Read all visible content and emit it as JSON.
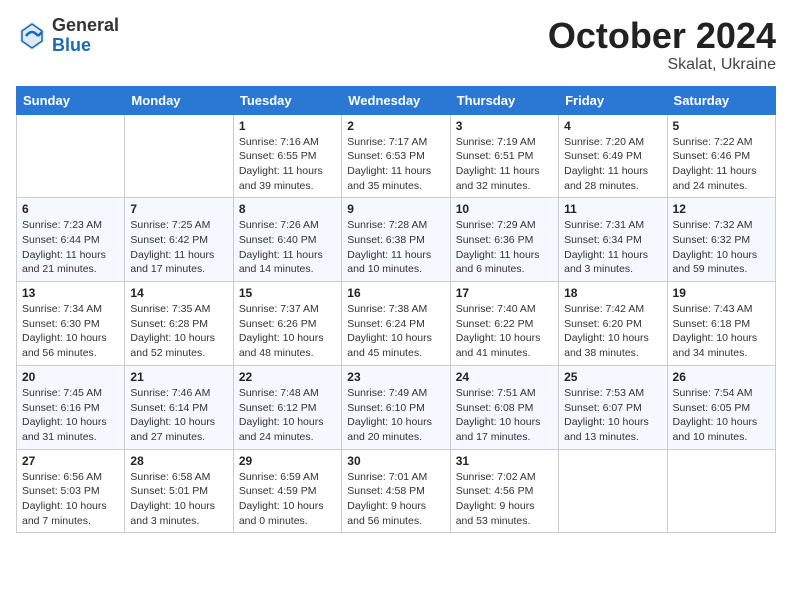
{
  "header": {
    "logo_general": "General",
    "logo_blue": "Blue",
    "month_title": "October 2024",
    "location": "Skalat, Ukraine"
  },
  "days_of_week": [
    "Sunday",
    "Monday",
    "Tuesday",
    "Wednesday",
    "Thursday",
    "Friday",
    "Saturday"
  ],
  "weeks": [
    [
      {
        "day": "",
        "sunrise": "",
        "sunset": "",
        "daylight": ""
      },
      {
        "day": "",
        "sunrise": "",
        "sunset": "",
        "daylight": ""
      },
      {
        "day": "1",
        "sunrise": "Sunrise: 7:16 AM",
        "sunset": "Sunset: 6:55 PM",
        "daylight": "Daylight: 11 hours and 39 minutes."
      },
      {
        "day": "2",
        "sunrise": "Sunrise: 7:17 AM",
        "sunset": "Sunset: 6:53 PM",
        "daylight": "Daylight: 11 hours and 35 minutes."
      },
      {
        "day": "3",
        "sunrise": "Sunrise: 7:19 AM",
        "sunset": "Sunset: 6:51 PM",
        "daylight": "Daylight: 11 hours and 32 minutes."
      },
      {
        "day": "4",
        "sunrise": "Sunrise: 7:20 AM",
        "sunset": "Sunset: 6:49 PM",
        "daylight": "Daylight: 11 hours and 28 minutes."
      },
      {
        "day": "5",
        "sunrise": "Sunrise: 7:22 AM",
        "sunset": "Sunset: 6:46 PM",
        "daylight": "Daylight: 11 hours and 24 minutes."
      }
    ],
    [
      {
        "day": "6",
        "sunrise": "Sunrise: 7:23 AM",
        "sunset": "Sunset: 6:44 PM",
        "daylight": "Daylight: 11 hours and 21 minutes."
      },
      {
        "day": "7",
        "sunrise": "Sunrise: 7:25 AM",
        "sunset": "Sunset: 6:42 PM",
        "daylight": "Daylight: 11 hours and 17 minutes."
      },
      {
        "day": "8",
        "sunrise": "Sunrise: 7:26 AM",
        "sunset": "Sunset: 6:40 PM",
        "daylight": "Daylight: 11 hours and 14 minutes."
      },
      {
        "day": "9",
        "sunrise": "Sunrise: 7:28 AM",
        "sunset": "Sunset: 6:38 PM",
        "daylight": "Daylight: 11 hours and 10 minutes."
      },
      {
        "day": "10",
        "sunrise": "Sunrise: 7:29 AM",
        "sunset": "Sunset: 6:36 PM",
        "daylight": "Daylight: 11 hours and 6 minutes."
      },
      {
        "day": "11",
        "sunrise": "Sunrise: 7:31 AM",
        "sunset": "Sunset: 6:34 PM",
        "daylight": "Daylight: 11 hours and 3 minutes."
      },
      {
        "day": "12",
        "sunrise": "Sunrise: 7:32 AM",
        "sunset": "Sunset: 6:32 PM",
        "daylight": "Daylight: 10 hours and 59 minutes."
      }
    ],
    [
      {
        "day": "13",
        "sunrise": "Sunrise: 7:34 AM",
        "sunset": "Sunset: 6:30 PM",
        "daylight": "Daylight: 10 hours and 56 minutes."
      },
      {
        "day": "14",
        "sunrise": "Sunrise: 7:35 AM",
        "sunset": "Sunset: 6:28 PM",
        "daylight": "Daylight: 10 hours and 52 minutes."
      },
      {
        "day": "15",
        "sunrise": "Sunrise: 7:37 AM",
        "sunset": "Sunset: 6:26 PM",
        "daylight": "Daylight: 10 hours and 48 minutes."
      },
      {
        "day": "16",
        "sunrise": "Sunrise: 7:38 AM",
        "sunset": "Sunset: 6:24 PM",
        "daylight": "Daylight: 10 hours and 45 minutes."
      },
      {
        "day": "17",
        "sunrise": "Sunrise: 7:40 AM",
        "sunset": "Sunset: 6:22 PM",
        "daylight": "Daylight: 10 hours and 41 minutes."
      },
      {
        "day": "18",
        "sunrise": "Sunrise: 7:42 AM",
        "sunset": "Sunset: 6:20 PM",
        "daylight": "Daylight: 10 hours and 38 minutes."
      },
      {
        "day": "19",
        "sunrise": "Sunrise: 7:43 AM",
        "sunset": "Sunset: 6:18 PM",
        "daylight": "Daylight: 10 hours and 34 minutes."
      }
    ],
    [
      {
        "day": "20",
        "sunrise": "Sunrise: 7:45 AM",
        "sunset": "Sunset: 6:16 PM",
        "daylight": "Daylight: 10 hours and 31 minutes."
      },
      {
        "day": "21",
        "sunrise": "Sunrise: 7:46 AM",
        "sunset": "Sunset: 6:14 PM",
        "daylight": "Daylight: 10 hours and 27 minutes."
      },
      {
        "day": "22",
        "sunrise": "Sunrise: 7:48 AM",
        "sunset": "Sunset: 6:12 PM",
        "daylight": "Daylight: 10 hours and 24 minutes."
      },
      {
        "day": "23",
        "sunrise": "Sunrise: 7:49 AM",
        "sunset": "Sunset: 6:10 PM",
        "daylight": "Daylight: 10 hours and 20 minutes."
      },
      {
        "day": "24",
        "sunrise": "Sunrise: 7:51 AM",
        "sunset": "Sunset: 6:08 PM",
        "daylight": "Daylight: 10 hours and 17 minutes."
      },
      {
        "day": "25",
        "sunrise": "Sunrise: 7:53 AM",
        "sunset": "Sunset: 6:07 PM",
        "daylight": "Daylight: 10 hours and 13 minutes."
      },
      {
        "day": "26",
        "sunrise": "Sunrise: 7:54 AM",
        "sunset": "Sunset: 6:05 PM",
        "daylight": "Daylight: 10 hours and 10 minutes."
      }
    ],
    [
      {
        "day": "27",
        "sunrise": "Sunrise: 6:56 AM",
        "sunset": "Sunset: 5:03 PM",
        "daylight": "Daylight: 10 hours and 7 minutes."
      },
      {
        "day": "28",
        "sunrise": "Sunrise: 6:58 AM",
        "sunset": "Sunset: 5:01 PM",
        "daylight": "Daylight: 10 hours and 3 minutes."
      },
      {
        "day": "29",
        "sunrise": "Sunrise: 6:59 AM",
        "sunset": "Sunset: 4:59 PM",
        "daylight": "Daylight: 10 hours and 0 minutes."
      },
      {
        "day": "30",
        "sunrise": "Sunrise: 7:01 AM",
        "sunset": "Sunset: 4:58 PM",
        "daylight": "Daylight: 9 hours and 56 minutes."
      },
      {
        "day": "31",
        "sunrise": "Sunrise: 7:02 AM",
        "sunset": "Sunset: 4:56 PM",
        "daylight": "Daylight: 9 hours and 53 minutes."
      },
      {
        "day": "",
        "sunrise": "",
        "sunset": "",
        "daylight": ""
      },
      {
        "day": "",
        "sunrise": "",
        "sunset": "",
        "daylight": ""
      }
    ]
  ]
}
